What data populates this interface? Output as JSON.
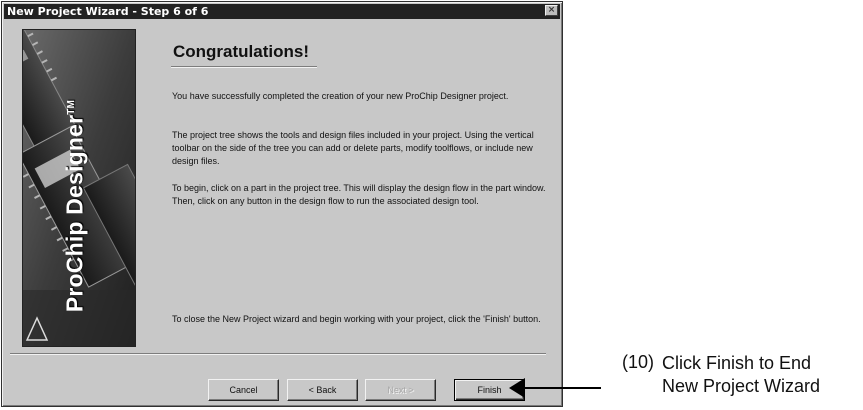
{
  "window": {
    "title": "New Project Wizard - Step 6 of 6",
    "close_glyph": "×"
  },
  "sidebar": {
    "brand_text": "ProChip Designer",
    "brand_mark": "TM"
  },
  "main": {
    "heading": "Congratulations!",
    "paragraphs": [
      "You have successfully completed the creation of your new ProChip Designer project.",
      "The project tree shows the tools and design files included in your project.  Using the vertical toolbar on the side of the tree you can add or delete parts, modify toolflows, or include new design files.",
      "To begin, click on a part in the project tree.  This will display the design flow in the part window.  Then, click on any button in the design flow to run the associated design tool.",
      "To close the New Project wizard and begin working with your project, click the 'Finish' button."
    ]
  },
  "buttons": {
    "cancel": "Cancel",
    "back": "< Back",
    "next": "Next >",
    "finish": "Finish"
  },
  "annotation": {
    "number": "(10)",
    "line1": "Click Finish to End",
    "line2": "New Project Wizard"
  },
  "colors": {
    "dialog_face": "#c8c8c8",
    "titlebar": "#222222"
  }
}
